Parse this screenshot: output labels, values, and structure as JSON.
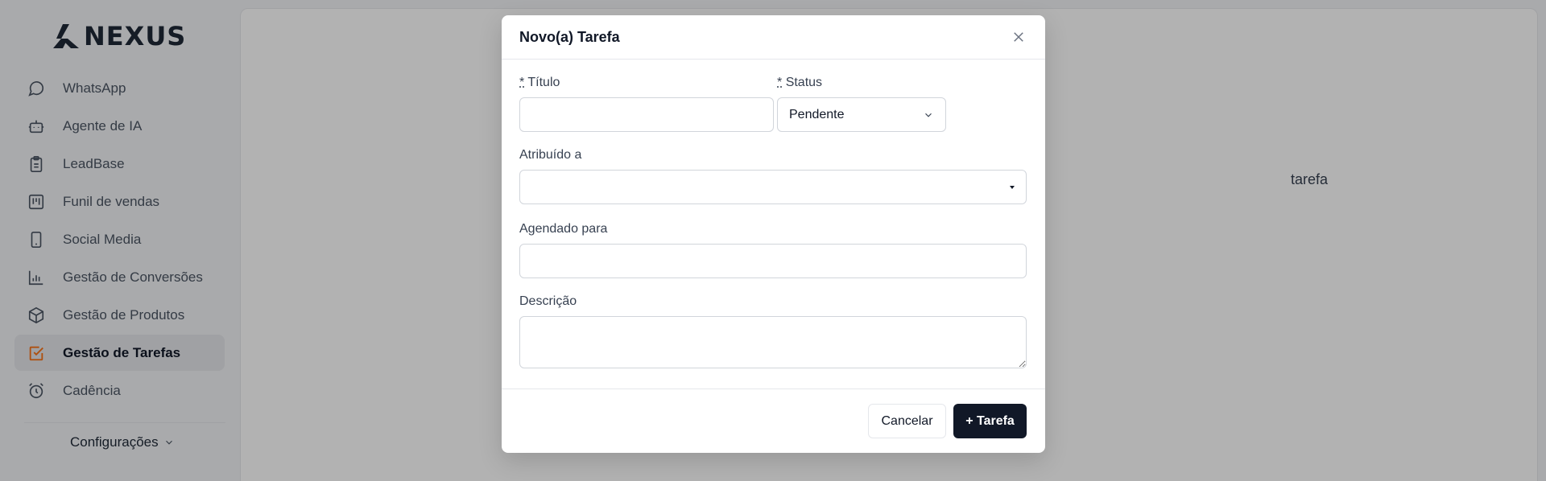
{
  "brand": {
    "name": "NEXUS"
  },
  "sidebar": {
    "items": [
      {
        "label": "WhatsApp",
        "icon": "message-circle-icon"
      },
      {
        "label": "Agente de IA",
        "icon": "bot-icon"
      },
      {
        "label": "LeadBase",
        "icon": "clipboard-icon"
      },
      {
        "label": "Funil de vendas",
        "icon": "kanban-icon"
      },
      {
        "label": "Social Media",
        "icon": "smartphone-icon"
      },
      {
        "label": "Gestão de Conversões",
        "icon": "bar-chart-icon"
      },
      {
        "label": "Gestão de Produtos",
        "icon": "package-icon"
      },
      {
        "label": "Gestão de Tarefas",
        "icon": "check-square-icon",
        "active": true
      },
      {
        "label": "Cadência",
        "icon": "alarm-clock-icon"
      }
    ],
    "config_label": "Configurações"
  },
  "main": {
    "background_text": "tarefa"
  },
  "modal": {
    "title": "Novo(a) Tarefa",
    "required_mark": "*",
    "fields": {
      "titulo": {
        "label": "Título",
        "value": ""
      },
      "status": {
        "label": "Status",
        "value": "Pendente"
      },
      "atribuido": {
        "label": "Atribuído a",
        "value": ""
      },
      "agendado": {
        "label": "Agendado para",
        "value": ""
      },
      "descricao": {
        "label": "Descrição",
        "value": ""
      }
    },
    "cancel_label": "Cancelar",
    "submit_label": "+ Tarefa"
  },
  "colors": {
    "accent": "#f97316",
    "primary_button": "#111827"
  }
}
